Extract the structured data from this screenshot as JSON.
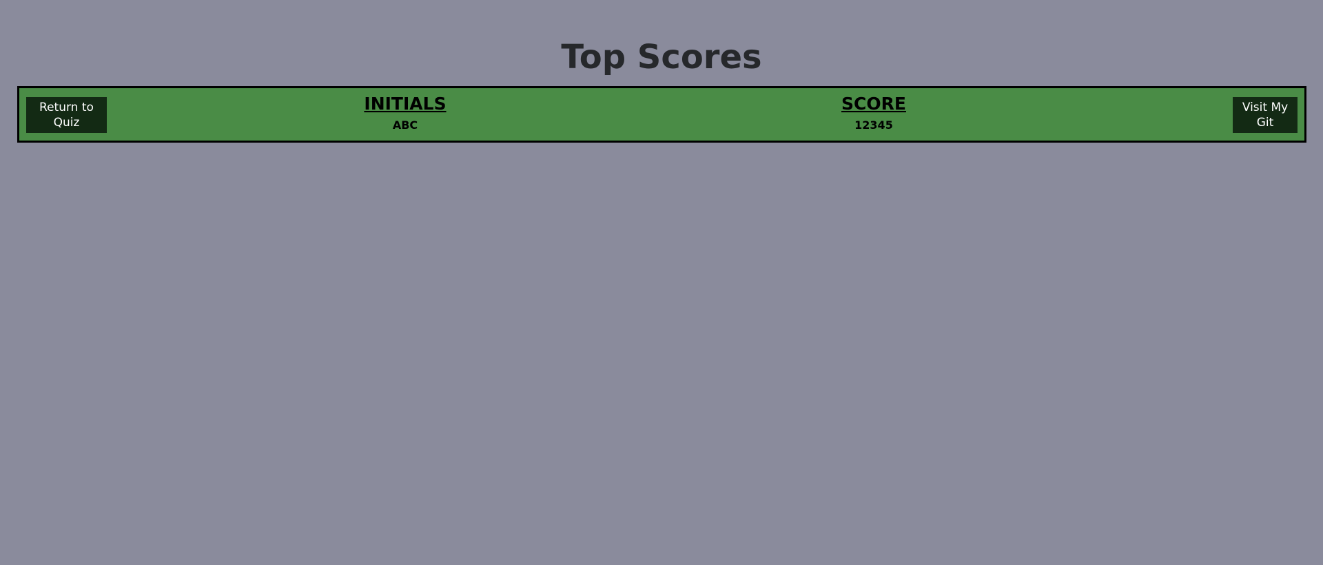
{
  "page": {
    "title": "Top Scores"
  },
  "colors": {
    "background": "#8a8b9c",
    "bar": "#4a8c46",
    "button": "#132a14",
    "title_text": "#26282b"
  },
  "buttons": {
    "return_label": "Return to Quiz",
    "git_label": "Visit My Git"
  },
  "scores": {
    "initials_header": "INITIALS",
    "score_header": "SCORE",
    "rows": [
      {
        "initials": "ABC",
        "score": "12345"
      }
    ]
  }
}
